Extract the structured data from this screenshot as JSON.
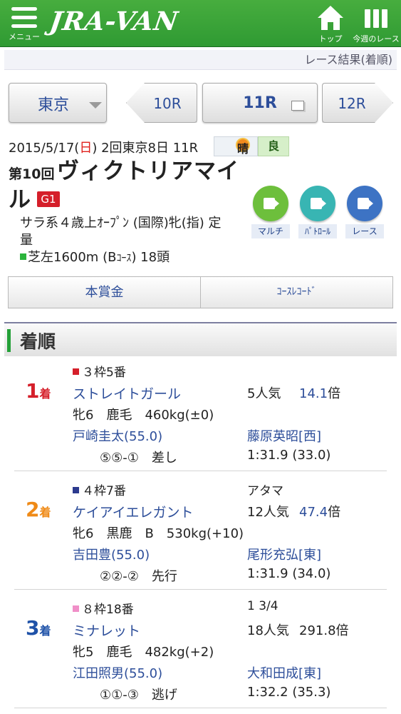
{
  "header": {
    "menu_label": "メニュー",
    "logo": "JRA-VAN",
    "top_label": "トップ",
    "week_label": "今週のレース",
    "bg_color": "#2f9a33"
  },
  "result_link": "レース結果(着順)",
  "nav": {
    "venue": "東京",
    "prev_race": "10R",
    "current_race": "11R",
    "next_race": "12R"
  },
  "race": {
    "date_prefix": "2015/5/17(",
    "date_day": "日",
    "date_suffix": ") 2回東京8日 11R",
    "weather": "晴",
    "track": "良",
    "number": "第10回",
    "name_line1": "ヴィクトリアマイ",
    "name_line2": "ル",
    "grade": "G1",
    "conditions_line1": "サラ系４歳上ｵｰﾌﾟﾝ (国際)牝(指) 定",
    "conditions_line2": "量",
    "course_main": "芝左1600m (B",
    "course_small": "ｺｰｽ",
    "course_end": ") 18頭",
    "grade_color": "#d51f2a"
  },
  "videos": [
    {
      "label": "マルチ",
      "color": "#6dbf3c",
      "icon": "video-camera-icon"
    },
    {
      "label": "ﾊﾟﾄﾛｰﾙ",
      "color": "#38b5b3",
      "icon": "video-camera-icon"
    },
    {
      "label": "レース",
      "color": "#3d73c4",
      "icon": "video-camera-icon"
    }
  ],
  "buttons": {
    "prize": "本賞金",
    "course_record": "ｺｰｽﾚｺｰﾄﾞ"
  },
  "section_title": "着順",
  "results": [
    {
      "rank": "1",
      "rank_suffix": "着",
      "rank_color": "#d51f2a",
      "frame_color": "#d51f2a",
      "frame": "３枠5番",
      "margin": "",
      "horse": "ストレイトガール",
      "popularity": "5人気",
      "odds": "14.1",
      "odds_suffix": "倍",
      "odds_color": "#2d4e9a",
      "details": "牝6　鹿毛　460kg(±0)",
      "jockey": "戸崎圭太(55.0)",
      "trainer": "藤原英昭[西]",
      "corners": "⑤⑤-①　差し",
      "time": "1:31.9 (33.0)"
    },
    {
      "rank": "2",
      "rank_suffix": "着",
      "rank_color": "#ef8a17",
      "frame_color": "#2c3a8e",
      "frame": "４枠7番",
      "margin": "アタマ",
      "horse": "ケイアイエレガント",
      "popularity": "12人気",
      "odds": "47.4",
      "odds_suffix": "倍",
      "odds_color": "#2d4e9a",
      "details": "牝6　黒鹿　B　530kg(+10)",
      "jockey": "吉田豊(55.0)",
      "trainer": "尾形充弘[東]",
      "corners": "②②-②　先行",
      "time": "1:31.9 (34.0)"
    },
    {
      "rank": "3",
      "rank_suffix": "着",
      "rank_color": "#1f52a8",
      "frame_color": "#f08fc8",
      "frame": "８枠18番",
      "margin": "1 3/4",
      "horse": "ミナレット",
      "popularity": "18人気",
      "odds": "291.8",
      "odds_suffix": "倍",
      "odds_color": "#222222",
      "details": "牝5　鹿毛　482kg(+2)",
      "jockey": "江田照男(55.0)",
      "trainer": "大和田成[東]",
      "corners": "①①-③　逃げ",
      "time": "1:32.2 (35.3)"
    }
  ]
}
